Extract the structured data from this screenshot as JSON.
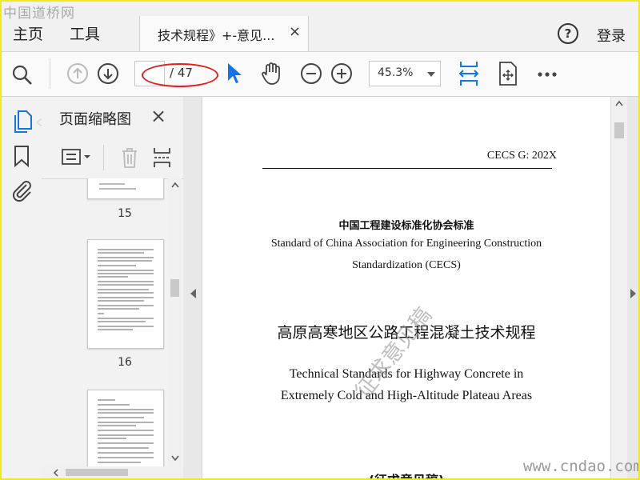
{
  "menu": {
    "home": "主页",
    "tools": "工具",
    "signin": "登录"
  },
  "tab": {
    "title": "技术规程》+-意见...",
    "close": "×"
  },
  "toolbar": {
    "page_current": "",
    "page_total": "/ 47",
    "zoom": "45.3%"
  },
  "panel": {
    "title": "页面缩略图",
    "close": "×",
    "thumbnails": [
      {
        "page": "15"
      },
      {
        "page": "16"
      }
    ]
  },
  "document": {
    "code": "CECS G: 202X",
    "org_cn": "中国工程建设标准化协会标准",
    "org_en_1": "Standard of China Association for Engineering Construction",
    "org_en_2": "Standardization (CECS)",
    "title_cn": "高原高寒地区公路工程混凝土技术规程",
    "title_en_1": "Technical Standards for Highway Concrete in",
    "title_en_2": "Extremely Cold and High-Altitude Plateau Areas",
    "draft_label": "(征求意见稿)",
    "watermark": "征求意见稿"
  },
  "overlays": {
    "top_left": "中国道桥网",
    "bottom_right": "www.cndao.com"
  },
  "colors": {
    "accent": "#1473e6",
    "highlight": "#e02020",
    "frame": "#f2e62a"
  }
}
